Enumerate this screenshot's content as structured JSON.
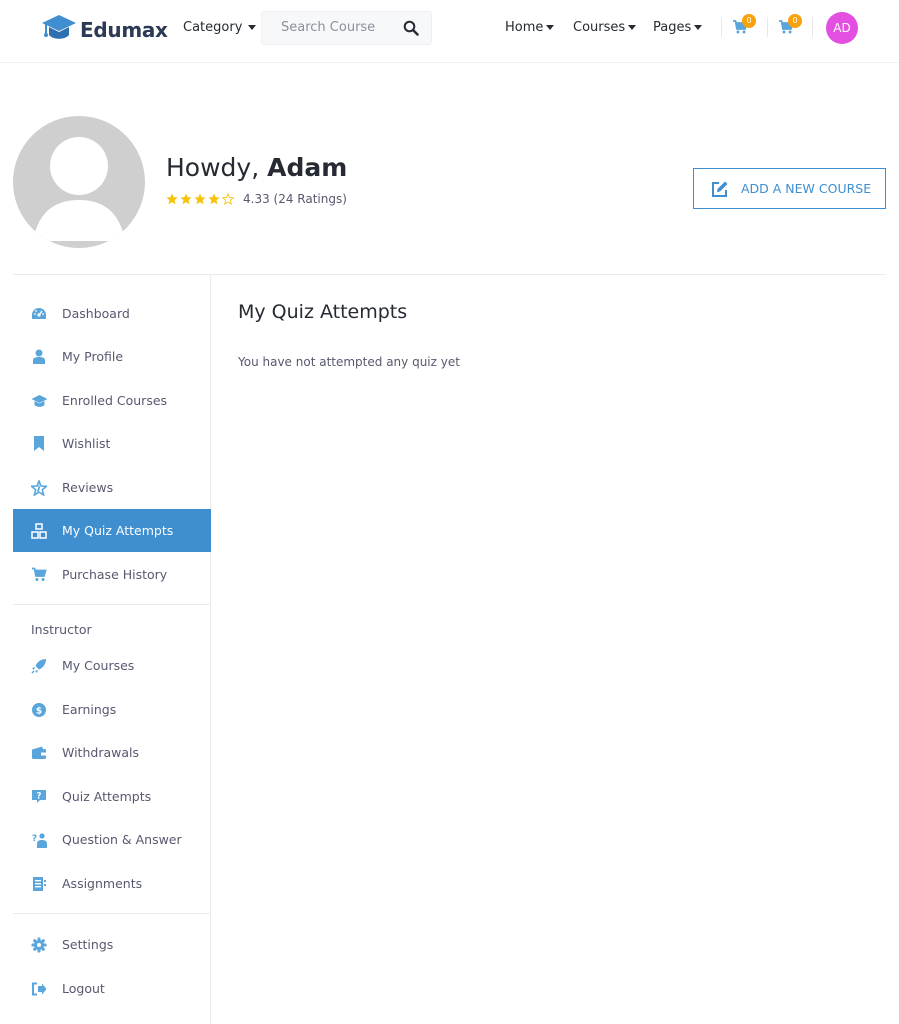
{
  "header": {
    "logo_text": "Edumax",
    "category_label": "Category",
    "search_placeholder": "Search Course",
    "nav": [
      {
        "label": "Home"
      },
      {
        "label": "Courses"
      },
      {
        "label": "Pages"
      }
    ],
    "cart_badges": [
      "0",
      "0"
    ],
    "avatar_initials": "AD"
  },
  "profile": {
    "greeting_prefix": "Howdy, ",
    "name": "Adam",
    "rating_text": "4.33 (24 Ratings)",
    "rating_value": 4.33,
    "stars_max": 5,
    "add_course_label": "ADD A NEW COURSE"
  },
  "sidebar": {
    "items": [
      {
        "label": "Dashboard",
        "icon": "dashboard-icon"
      },
      {
        "label": "My Profile",
        "icon": "user-icon"
      },
      {
        "label": "Enrolled Courses",
        "icon": "graduation-cap-icon"
      },
      {
        "label": "Wishlist",
        "icon": "bookmark-icon"
      },
      {
        "label": "Reviews",
        "icon": "star-icon"
      },
      {
        "label": "My Quiz Attempts",
        "icon": "quiz-blocks-icon",
        "active": true
      },
      {
        "label": "Purchase History",
        "icon": "cart-icon"
      }
    ],
    "instructor_heading": "Instructor",
    "instructor_items": [
      {
        "label": "My Courses",
        "icon": "rocket-icon"
      },
      {
        "label": "Earnings",
        "icon": "dollar-icon"
      },
      {
        "label": "Withdrawals",
        "icon": "wallet-icon"
      },
      {
        "label": "Quiz Attempts",
        "icon": "question-box-icon"
      },
      {
        "label": "Question & Answer",
        "icon": "question-answer-icon"
      },
      {
        "label": "Assignments",
        "icon": "assignment-icon"
      }
    ],
    "bottom_items": [
      {
        "label": "Settings",
        "icon": "gear-icon"
      },
      {
        "label": "Logout",
        "icon": "logout-icon"
      }
    ]
  },
  "main": {
    "title": "My Quiz Attempts",
    "empty_message": "You have not attempted any quiz yet"
  },
  "colors": {
    "accent": "#3e8ed0",
    "star": "#f7c20b",
    "badge": "#f7a10c",
    "avatar": "#e24fe1",
    "icon": "#5aa6dc"
  }
}
